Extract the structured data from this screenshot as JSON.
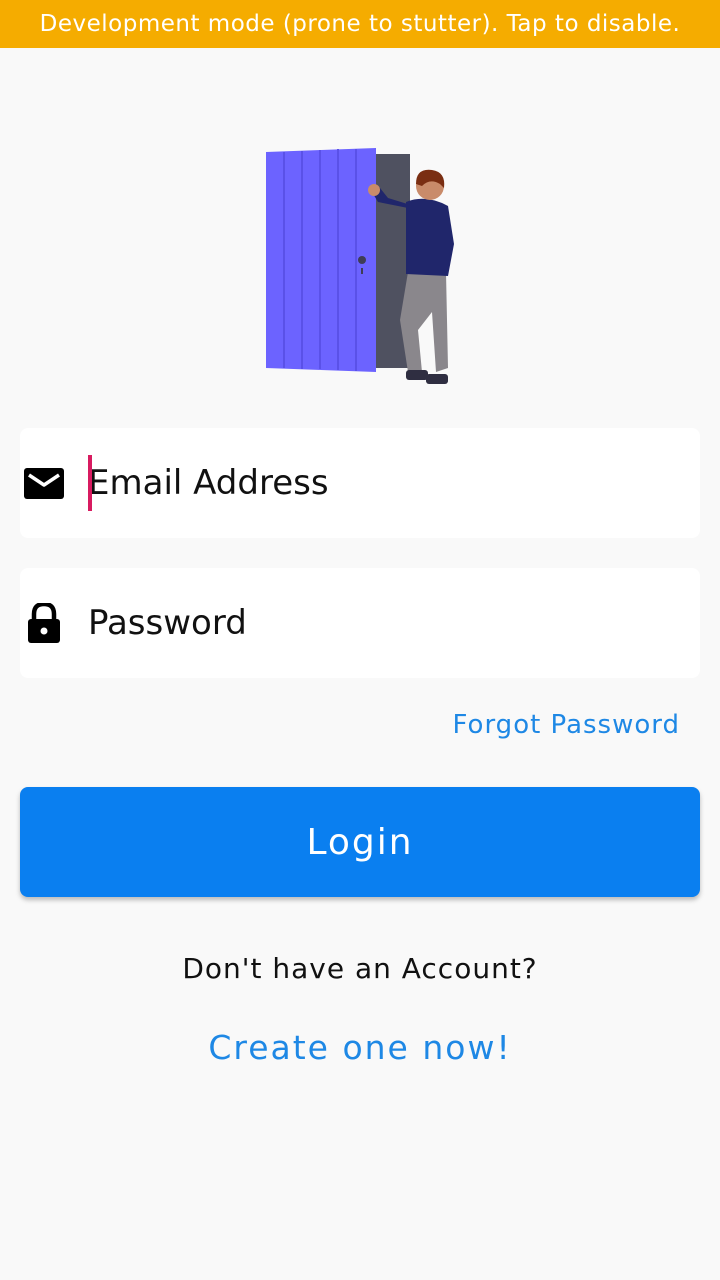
{
  "banner": {
    "text": "Development mode (prone to stutter). Tap to disable."
  },
  "form": {
    "email_placeholder": "Email Address",
    "password_placeholder": "Password",
    "forgot_label": "Forgot Password",
    "login_label": "Login"
  },
  "footer": {
    "no_account_text": "Don't have an Account?",
    "create_label": "Create one now!"
  },
  "icons": {
    "email": "envelope-icon",
    "password": "lock-icon"
  },
  "colors": {
    "banner_bg": "#f5ac00",
    "primary": "#0a7ff0",
    "link": "#1e88e5",
    "caret": "#d81b60",
    "door": "#6c63ff"
  }
}
